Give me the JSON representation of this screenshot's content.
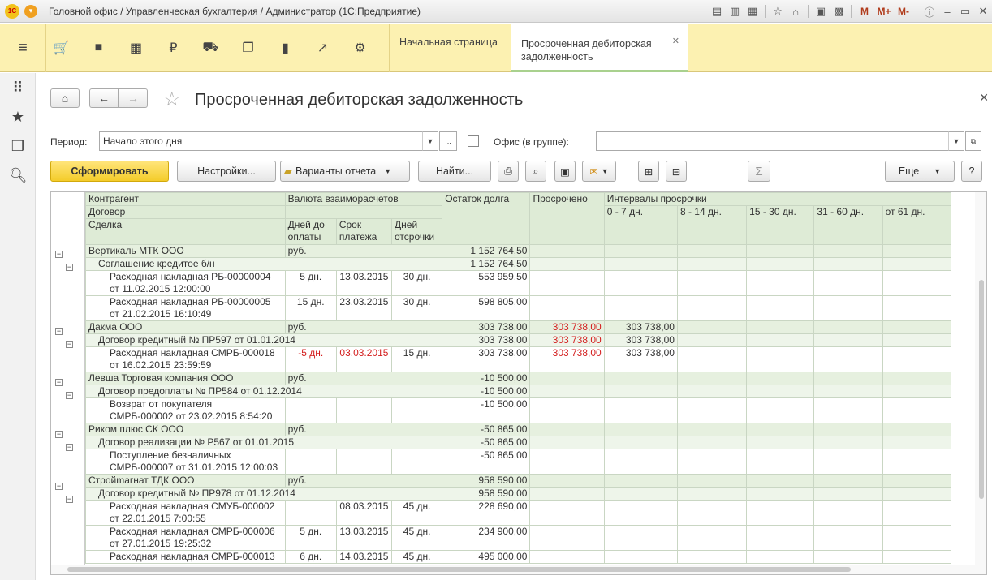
{
  "window": {
    "title": "Головной офис / Управленческая бухгалтерия / Администратор  (1С:Предприятие)",
    "logo_text": "1С"
  },
  "sections": {
    "tabs": [
      {
        "label": "Начальная страница"
      },
      {
        "label": "Просроченная дебиторская задолженность"
      }
    ]
  },
  "page": {
    "title": "Просроченная дебиторская задолженность",
    "period_label": "Период:",
    "period_value": "Начало этого дня",
    "office_label": "Офис (в группе):",
    "office_value": "",
    "ellipsis": "..."
  },
  "toolbar": {
    "generate": "Сформировать",
    "settings": "Настройки...",
    "variants": "Варианты отчета",
    "find": "Найти...",
    "more": "Еще",
    "help": "?",
    "sum": "Σ"
  },
  "table": {
    "headers": {
      "counterparty": "Контрагент",
      "contract": "Договор",
      "deal": "Сделка",
      "currency": "Валюта взаиморасчетов",
      "days_to_pay": "Дней до оплаты",
      "due_date": "Срок платежа",
      "deferral_days": "Дней отсрочки",
      "debt": "Остаток долга",
      "overdue": "Просрочено",
      "intervals": "Интервалы просрочки",
      "i0_7": "0 - 7 дн.",
      "i8_14": "8 - 14 дн.",
      "i15_30": "15 - 30 дн.",
      "i31_60": "31 - 60 дн.",
      "i61": "от 61 дн."
    },
    "rows": [
      {
        "level": 1,
        "name": "Вертикаль МТК ООО",
        "currency": "руб.",
        "debt": "1 152 764,50",
        "overdue": "",
        "i0_7": ""
      },
      {
        "level": 2,
        "name": "Соглашение кредитое б/н",
        "debt": "1 152 764,50",
        "overdue": "",
        "i0_7": ""
      },
      {
        "level": 3,
        "name": "Расходная накладная РБ-00000004",
        "name2": "от 11.02.2015 12:00:00",
        "days": "5 дн.",
        "due": "13.03.2015",
        "deferral": "30 дн.",
        "debt": "553 959,50",
        "overdue": "",
        "i0_7": ""
      },
      {
        "level": 3,
        "name": "Расходная накладная РБ-00000005",
        "name2": "от 21.02.2015 16:10:49",
        "days": "15 дн.",
        "due": "23.03.2015",
        "deferral": "30 дн.",
        "debt": "598 805,00",
        "overdue": "",
        "i0_7": ""
      },
      {
        "level": 1,
        "name": "Дакма ООО",
        "currency": "руб.",
        "debt": "303 738,00",
        "overdue": "303 738,00",
        "i0_7": "303 738,00"
      },
      {
        "level": 2,
        "name": "Договор кредитный № ПР597 от 01.01.2014",
        "debt": "303 738,00",
        "overdue": "303 738,00",
        "i0_7": "303 738,00"
      },
      {
        "level": 3,
        "name": "Расходная накладная СМРБ-000018",
        "name2": "от 16.02.2015 23:59:59",
        "days": "-5 дн.",
        "due": "03.03.2015",
        "deferral": "15 дн.",
        "debt": "303 738,00",
        "overdue": "303 738,00",
        "i0_7": "303 738,00"
      },
      {
        "level": 1,
        "name": "Левша Торговая компания ООО",
        "currency": "руб.",
        "debt": "-10 500,00",
        "overdue": "",
        "i0_7": ""
      },
      {
        "level": 2,
        "name": "Договор предоплаты № ПР584 от 01.12.2014",
        "debt": "-10 500,00",
        "overdue": "",
        "i0_7": ""
      },
      {
        "level": 3,
        "name": "Возврат от покупателя",
        "name2": "СМРБ-000002 от 23.02.2015 8:54:20",
        "days": "",
        "due": "",
        "deferral": "",
        "debt": "-10 500,00",
        "overdue": "",
        "i0_7": ""
      },
      {
        "level": 1,
        "name": "Риком плюс СК ООО",
        "currency": "руб.",
        "debt": "-50 865,00",
        "overdue": "",
        "i0_7": ""
      },
      {
        "level": 2,
        "name": "Договор реализации № Р567 от 01.01.2015",
        "debt": "-50 865,00",
        "overdue": "",
        "i0_7": ""
      },
      {
        "level": 3,
        "name": "Поступление безналичных",
        "name2": "СМРБ-000007 от 31.01.2015 12:00:03",
        "days": "",
        "due": "",
        "deferral": "",
        "debt": "-50 865,00",
        "overdue": "",
        "i0_7": ""
      },
      {
        "level": 1,
        "name": "Стройmагнат ТДК ООО",
        "currency": "руб.",
        "debt": "958 590,00",
        "overdue": "",
        "i0_7": ""
      },
      {
        "level": 2,
        "name": "Договор кредитный № ПР978 от 01.12.2014",
        "debt": "958 590,00",
        "overdue": "",
        "i0_7": ""
      },
      {
        "level": 3,
        "name": "Расходная накладная СМУБ-000002",
        "name2": "от 22.01.2015 7:00:55",
        "days": "",
        "due": "08.03.2015",
        "deferral": "45 дн.",
        "debt": "228 690,00",
        "overdue": "",
        "i0_7": ""
      },
      {
        "level": 3,
        "name": "Расходная накладная СМРБ-000006",
        "name2": "от 27.01.2015 19:25:32",
        "days": "5 дн.",
        "due": "13.03.2015",
        "deferral": "45 дн.",
        "debt": "234 900,00",
        "overdue": "",
        "i0_7": ""
      },
      {
        "level": 3,
        "name": "Расходная накладная СМРБ-000013",
        "name2": "",
        "days": "6 дн.",
        "due": "14.03.2015",
        "deferral": "45 дн.",
        "debt": "495 000,00",
        "overdue": "",
        "i0_7": ""
      }
    ]
  },
  "colors": {
    "accent_yellow": "#fcf1b1",
    "header_green": "#deebd6",
    "group_green": "#e6f0df",
    "overdue_red": "#d42020"
  }
}
